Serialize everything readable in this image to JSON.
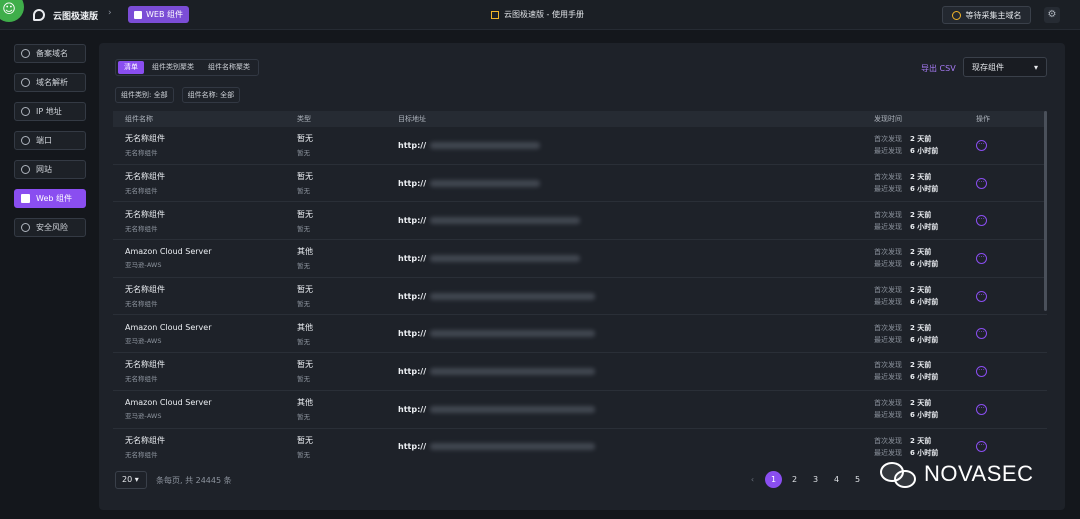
{
  "topbar": {
    "app_name": "云图极速版",
    "crumb": "WEB 组件",
    "manual": "云图极速版 - 使用手册",
    "collect_button": "等待采集主域名"
  },
  "sidebar": {
    "items": [
      {
        "label": "备案域名",
        "icon": "record-icon"
      },
      {
        "label": "域名解析",
        "icon": "globe-icon"
      },
      {
        "label": "IP 地址",
        "icon": "ip-icon"
      },
      {
        "label": "端口",
        "icon": "port-icon"
      },
      {
        "label": "网站",
        "icon": "browser-icon"
      },
      {
        "label": "Web 组件",
        "icon": "puzzle-icon",
        "active": true
      },
      {
        "label": "安全风险",
        "icon": "shield-icon"
      }
    ]
  },
  "tabs": [
    "清单",
    "组件类别聚类",
    "组件名称聚类"
  ],
  "export_label": "导出 CSV",
  "view_select": "现存组件",
  "filters": [
    "组件类别: 全部",
    "组件名称: 全部"
  ],
  "table": {
    "headers": {
      "name": "组件名称",
      "type": "类型",
      "url": "目标地址",
      "time": "发现时间",
      "op": "操作"
    },
    "rows": [
      {
        "name": "无名称组件",
        "sub": "无名称组件",
        "type": "暂无",
        "type_sub": "暂无",
        "url": "http://",
        "first_label": "首次发现",
        "first": "2 天前",
        "last_label": "最近发现",
        "last": "6 小时前"
      },
      {
        "name": "无名称组件",
        "sub": "无名称组件",
        "type": "暂无",
        "type_sub": "暂无",
        "url": "http://",
        "first_label": "首次发现",
        "first": "2 天前",
        "last_label": "最近发现",
        "last": "6 小时前"
      },
      {
        "name": "无名称组件",
        "sub": "无名称组件",
        "type": "暂无",
        "type_sub": "暂无",
        "url": "http://",
        "first_label": "首次发现",
        "first": "2 天前",
        "last_label": "最近发现",
        "last": "6 小时前"
      },
      {
        "name": "Amazon Cloud Server",
        "sub": "亚马逊-AWS",
        "type": "其他",
        "type_sub": "暂无",
        "url": "http://",
        "first_label": "首次发现",
        "first": "2 天前",
        "last_label": "最近发现",
        "last": "6 小时前"
      },
      {
        "name": "无名称组件",
        "sub": "无名称组件",
        "type": "暂无",
        "type_sub": "暂无",
        "url": "http://",
        "first_label": "首次发现",
        "first": "2 天前",
        "last_label": "最近发现",
        "last": "6 小时前"
      },
      {
        "name": "Amazon Cloud Server",
        "sub": "亚马逊-AWS",
        "type": "其他",
        "type_sub": "暂无",
        "url": "http://",
        "first_label": "首次发现",
        "first": "2 天前",
        "last_label": "最近发现",
        "last": "6 小时前"
      },
      {
        "name": "无名称组件",
        "sub": "无名称组件",
        "type": "暂无",
        "type_sub": "暂无",
        "url": "http://",
        "first_label": "首次发现",
        "first": "2 天前",
        "last_label": "最近发现",
        "last": "6 小时前"
      },
      {
        "name": "Amazon Cloud Server",
        "sub": "亚马逊-AWS",
        "type": "其他",
        "type_sub": "暂无",
        "url": "http://",
        "first_label": "首次发现",
        "first": "2 天前",
        "last_label": "最近发现",
        "last": "6 小时前"
      },
      {
        "name": "无名称组件",
        "sub": "无名称组件",
        "type": "暂无",
        "type_sub": "暂无",
        "url": "http://",
        "first_label": "首次发现",
        "first": "2 天前",
        "last_label": "最近发现",
        "last": "6 小时前"
      }
    ]
  },
  "footer": {
    "page_size": "20",
    "total_text": "条每页, 共 24445 条",
    "pages": [
      "1",
      "2",
      "3",
      "4",
      "5"
    ],
    "current_page": "1"
  },
  "watermark": "NOVASEC"
}
